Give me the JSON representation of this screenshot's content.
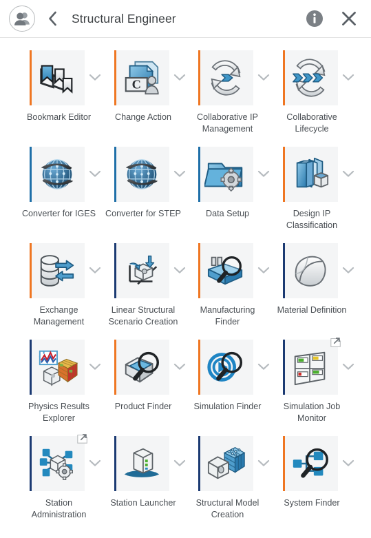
{
  "header": {
    "title": "Structural Engineer",
    "avatar_icon": "user-group-icon",
    "back_icon": "chevron-left-icon",
    "info_icon": "info-icon",
    "close_icon": "close-icon",
    "info_label": "Information",
    "close_label": "Close",
    "back_label": "Back"
  },
  "colors": {
    "accent_orange": "#ef7622",
    "accent_navy": "#1b3a72",
    "accent_blue": "#1e6fa8",
    "tile_bg": "#f4f5f6",
    "text": "#4a4f54",
    "header_text": "#3c4043",
    "icon_gray": "#7b8085"
  },
  "apps": [
    {
      "label": "Bookmark Editor",
      "icon": "bookmark-flags-icon",
      "accent": "orange",
      "expandable": true,
      "external": false
    },
    {
      "label": "Change Action",
      "icon": "change-action-icon",
      "accent": "orange",
      "expandable": true,
      "external": false
    },
    {
      "label": "Collaborative IP Management",
      "icon": "collaborative-ip-icon",
      "accent": "orange",
      "expandable": true,
      "external": false
    },
    {
      "label": "Collaborative Lifecycle",
      "icon": "collaborative-lifecycle-icon",
      "accent": "orange",
      "expandable": true,
      "external": false
    },
    {
      "label": "Converter for IGES",
      "icon": "globe-converter-icon",
      "accent": "blue",
      "expandable": true,
      "external": false
    },
    {
      "label": "Converter for STEP",
      "icon": "globe-converter-icon",
      "accent": "blue",
      "expandable": true,
      "external": false
    },
    {
      "label": "Data Setup",
      "icon": "folder-gear-icon",
      "accent": "blue",
      "expandable": true,
      "external": false
    },
    {
      "label": "Design IP Classification",
      "icon": "design-ip-books-icon",
      "accent": "orange",
      "expandable": true,
      "external": false
    },
    {
      "label": "Exchange Management",
      "icon": "database-exchange-icon",
      "accent": "orange",
      "expandable": true,
      "external": false
    },
    {
      "label": "Linear Structural Scenario Creation",
      "icon": "linear-structural-icon",
      "accent": "navy",
      "expandable": true,
      "external": false
    },
    {
      "label": "Manufacturing Finder",
      "icon": "manufacturing-finder-icon",
      "accent": "orange",
      "expandable": true,
      "external": false
    },
    {
      "label": "Material Definition",
      "icon": "material-definition-icon",
      "accent": "navy",
      "expandable": true,
      "external": false
    },
    {
      "label": "Physics Results Explorer",
      "icon": "physics-results-icon",
      "accent": "navy",
      "expandable": true,
      "external": false
    },
    {
      "label": "Product Finder",
      "icon": "product-finder-icon",
      "accent": "orange",
      "expandable": true,
      "external": false
    },
    {
      "label": "Simulation Finder",
      "icon": "simulation-finder-icon",
      "accent": "orange",
      "expandable": true,
      "external": false
    },
    {
      "label": "Simulation Job Monitor",
      "icon": "simulation-job-monitor-icon",
      "accent": "navy",
      "expandable": true,
      "external": true
    },
    {
      "label": "Station Administration",
      "icon": "station-administration-icon",
      "accent": "navy",
      "expandable": true,
      "external": true
    },
    {
      "label": "Station Launcher",
      "icon": "station-launcher-icon",
      "accent": "navy",
      "expandable": true,
      "external": false
    },
    {
      "label": "Structural Model Creation",
      "icon": "structural-model-icon",
      "accent": "navy",
      "expandable": true,
      "external": false
    },
    {
      "label": "System Finder",
      "icon": "system-finder-icon",
      "accent": "orange",
      "expandable": true,
      "external": false
    }
  ]
}
